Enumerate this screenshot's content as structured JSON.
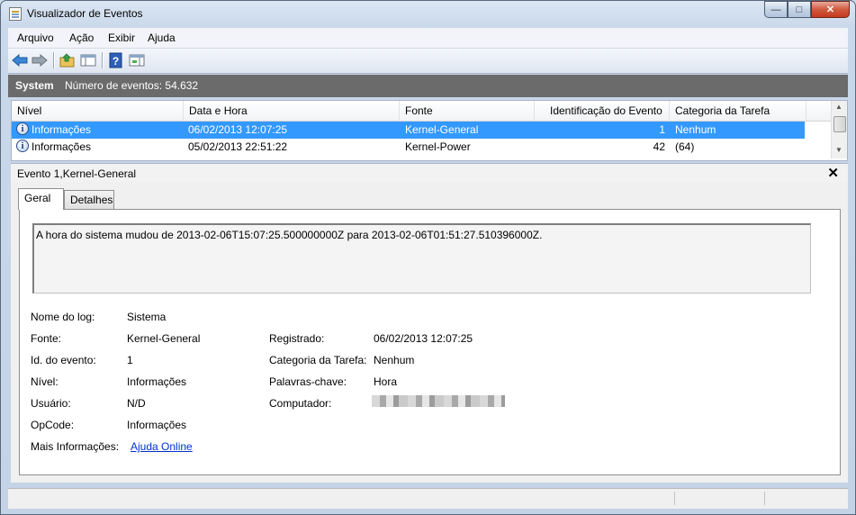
{
  "window": {
    "title": "Visualizador de Eventos",
    "buttons": {
      "minimize": "—",
      "maximize": "□",
      "close": "✕"
    }
  },
  "menu": [
    "Arquivo",
    "Ação",
    "Exibir",
    "Ajuda"
  ],
  "toolbar": {
    "icons": [
      "back-arrow-icon",
      "forward-arrow-icon",
      "folder-up-icon",
      "show-hide-tree-icon",
      "help-icon",
      "action-pane-icon"
    ]
  },
  "header": {
    "log_name": "System",
    "event_count": "Número de eventos: 54.632"
  },
  "grid": {
    "columns": [
      "Nível",
      "Data e Hora",
      "Fonte",
      "Identificação do Evento",
      "Categoria da Tarefa"
    ],
    "rows": [
      {
        "level": "Informações",
        "datetime": "06/02/2013 12:07:25",
        "source": "Kernel-General",
        "event_id": "1",
        "category": "Nenhum",
        "selected": true
      },
      {
        "level": "Informações",
        "datetime": "05/02/2013 22:51:22",
        "source": "Kernel-Power",
        "event_id": "42",
        "category": "(64)",
        "selected": false
      }
    ]
  },
  "detail": {
    "title": "Evento 1,Kernel-General",
    "close": "✕",
    "tabs": [
      "Geral",
      "Detalhes"
    ],
    "message": "A hora do sistema mudou de 2013-02-06T15:07:25.500000000Z para 2013-02-06T01:51:27.510396000Z.",
    "fields": {
      "log_name_label": "Nome do log:",
      "log_name_value": "Sistema",
      "source_label": "Fonte:",
      "source_value": "Kernel-General",
      "event_id_label": "Id. do evento:",
      "event_id_value": "1",
      "level_label": "Nível:",
      "level_value": "Informações",
      "user_label": "Usuário:",
      "user_value": "N/D",
      "opcode_label": "OpCode:",
      "opcode_value": "Informações",
      "more_info_label": "Mais Informações:",
      "more_info_link": "Ajuda Online",
      "logged_label": "Registrado:",
      "logged_value": "06/02/2013 12:07:25",
      "task_category_label": "Categoria da Tarefa:",
      "task_category_value": "Nenhum",
      "keywords_label": "Palavras-chave:",
      "keywords_value": "Hora",
      "computer_label": "Computador:"
    }
  },
  "colors": {
    "header_bar": "#6b6b6b",
    "selection": "#3399ff",
    "link": "#0033cc"
  }
}
